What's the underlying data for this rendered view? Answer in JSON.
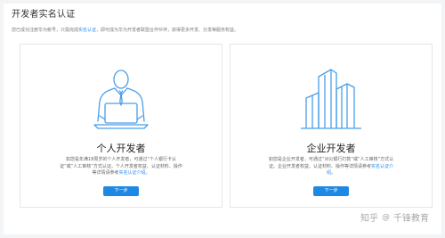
{
  "page": {
    "title": "开发者实名认证",
    "subtitle_prefix": "您已成功注册华为帐号，只需完成",
    "subtitle_link": "实名认证",
    "subtitle_suffix": "，即可成为华为开发者联盟合作伙伴，获得更多开发、分发等服务权益。"
  },
  "cards": [
    {
      "title": "个人开发者",
      "desc_prefix": "如您是年满18周岁的个人开发者，可通过“个人银行卡认证”或“人工审核”方式认证。个人开发者权益、认证材料、操作等详情请参考",
      "desc_link": "实名认证介绍",
      "desc_suffix": "。",
      "button": "下一步",
      "icon": "person-at-laptop-icon"
    },
    {
      "title": "企业开发者",
      "desc_prefix": "如您是企业开发者，可通过“对公银行打款”或“人工审核”方式认证。企业开发者权益、认证材料、操作等详情请参考",
      "desc_link": "实名认证介绍",
      "desc_suffix": "。",
      "button": "下一步",
      "icon": "office-buildings-icon"
    }
  ],
  "watermark": {
    "brand": "知乎",
    "at": "@",
    "name": "千锋教育"
  },
  "colors": {
    "accent": "#1e88e5",
    "link": "#2d8cf0",
    "illustration": "#4a9ee8"
  }
}
